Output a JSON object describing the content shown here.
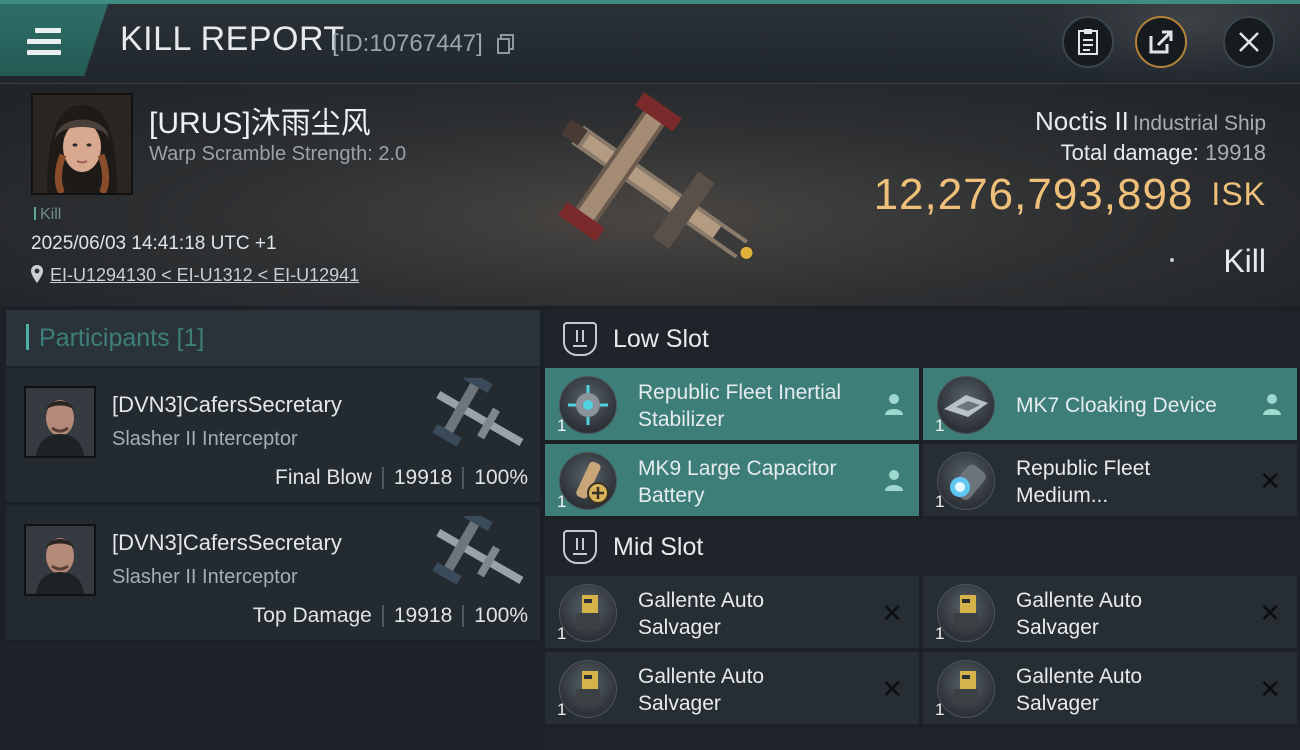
{
  "header": {
    "title": "KILL REPORT",
    "report_id": "[ID:10767447]",
    "icons": [
      "menu-icon",
      "copy-icon",
      "clipboard-icon",
      "share-icon",
      "close-icon"
    ]
  },
  "victim": {
    "pilot_name": "[URUS]沐雨尘风",
    "warp_scramble": "Warp Scramble Strength: 2.0",
    "kill_tag": "Kill",
    "datetime": "2025/06/03 14:41:18 UTC +1",
    "location": "EI-U1294130 < EI-U1312 < EI-U12941",
    "ship_name": "Noctis II",
    "ship_class": "Industrial Ship",
    "total_damage_label": "Total damage:",
    "total_damage": "19918",
    "isk_value": "12,276,793,898",
    "isk_unit": "ISK",
    "result": "Kill"
  },
  "participants": {
    "title": "Participants [1]",
    "rows": [
      {
        "name": "[DVN3]CafersSecretary",
        "ship": "Slasher II Interceptor",
        "role": "Final Blow",
        "damage": "19918",
        "percent": "100%"
      },
      {
        "name": "[DVN3]CafersSecretary",
        "ship": "Slasher II Interceptor",
        "role": "Top Damage",
        "damage": "19918",
        "percent": "100%"
      }
    ]
  },
  "slots": {
    "low": {
      "title": "Low Slot",
      "items": [
        {
          "name_line1": "Republic Fleet Inertial",
          "name_line2": "Stabilizer",
          "qty": "1",
          "status": "dropped"
        },
        {
          "name_line1": "MK7 Cloaking Device",
          "name_line2": "",
          "qty": "1",
          "status": "dropped"
        },
        {
          "name_line1": "MK9 Large Capacitor",
          "name_line2": "Battery",
          "qty": "1",
          "status": "dropped"
        },
        {
          "name_line1": "Republic Fleet",
          "name_line2": "Medium...",
          "qty": "1",
          "status": "destroyed"
        }
      ]
    },
    "mid": {
      "title": "Mid Slot",
      "items": [
        {
          "name_line1": "Gallente Auto",
          "name_line2": "Salvager",
          "qty": "1",
          "status": "destroyed"
        },
        {
          "name_line1": "Gallente Auto",
          "name_line2": "Salvager",
          "qty": "1",
          "status": "destroyed"
        },
        {
          "name_line1": "Gallente Auto",
          "name_line2": "Salvager",
          "qty": "1",
          "status": "destroyed"
        },
        {
          "name_line1": "Gallente Auto",
          "name_line2": "Salvager",
          "qty": "1",
          "status": "destroyed"
        }
      ]
    },
    "x_glyph": "✕"
  },
  "colors": {
    "accent_teal": "#3d7f78",
    "isk_gold": "#eec07a",
    "highlight_border": "#b5823a"
  }
}
